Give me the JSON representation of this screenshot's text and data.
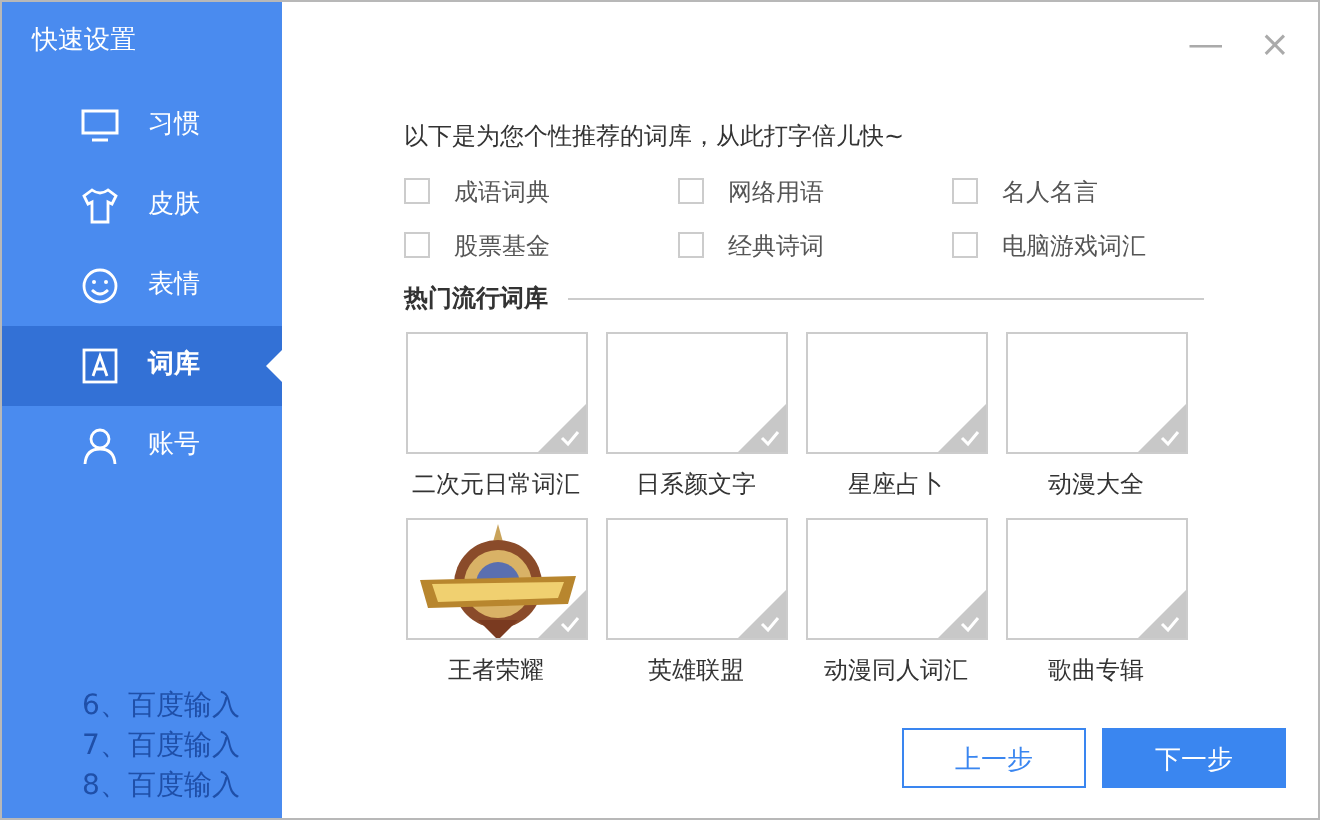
{
  "sidebar": {
    "title": "快速设置",
    "items": [
      {
        "label": "习惯",
        "selected": false
      },
      {
        "label": "皮肤",
        "selected": false
      },
      {
        "label": "表情",
        "selected": false
      },
      {
        "label": "词库",
        "selected": true
      },
      {
        "label": "账号",
        "selected": false
      }
    ],
    "background_lines": [
      "6、百度输入",
      "7、百度输入",
      "8、百度输入"
    ]
  },
  "window_controls": [
    "—",
    "×"
  ],
  "intro": "以下是为您个性推荐的词库，从此打字倍儿快~",
  "options": [
    {
      "label": "成语词典",
      "checked": false
    },
    {
      "label": "网络用语",
      "checked": false
    },
    {
      "label": "名人名言",
      "checked": false
    },
    {
      "label": "股票基金",
      "checked": false
    },
    {
      "label": "经典诗词",
      "checked": false
    },
    {
      "label": "电脑游戏词汇",
      "checked": false
    }
  ],
  "section_title": "热门流行词库",
  "cards": [
    {
      "label": "二次元日常词汇",
      "selected": false
    },
    {
      "label": "日系颜文字",
      "selected": false
    },
    {
      "label": "星座占卜",
      "selected": false
    },
    {
      "label": "动漫大全",
      "selected": false
    },
    {
      "label": "王者荣耀",
      "selected": false,
      "kind": "picture"
    },
    {
      "label": "英雄联盟",
      "selected": false
    },
    {
      "label": "动漫同人词汇",
      "selected": false
    },
    {
      "label": "歌曲专辑",
      "selected": false
    }
  ],
  "buttons": [
    {
      "label": "上一步",
      "kind": "secondary"
    },
    {
      "label": "下一步",
      "kind": "primary"
    }
  ]
}
